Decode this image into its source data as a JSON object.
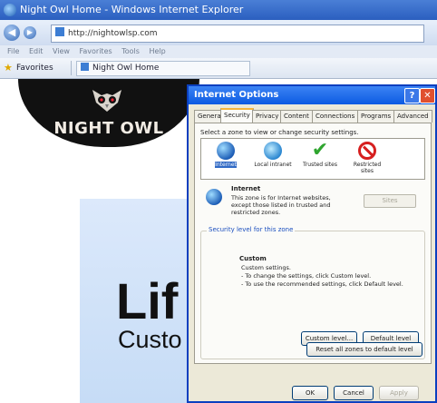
{
  "browser": {
    "title": "Night Owl Home - Windows Internet Explorer",
    "address": "http://nightowlsp.com",
    "menu": [
      "File",
      "Edit",
      "View",
      "Favorites",
      "Tools",
      "Help"
    ],
    "favorites_label": "Favorites",
    "tab_label": "Night Owl Home"
  },
  "page": {
    "brand": "NIGHT OWL",
    "promo_big": "Lif",
    "promo_sub": "Custo"
  },
  "dialog": {
    "title": "Internet Options",
    "tabs": [
      "General",
      "Security",
      "Privacy",
      "Content",
      "Connections",
      "Programs",
      "Advanced"
    ],
    "active_tab": "Security",
    "zone_caption": "Select a zone to view or change security settings.",
    "zones": [
      "Internet",
      "Local intranet",
      "Trusted sites",
      "Restricted sites"
    ],
    "sites_button": "Sites",
    "zone_title": "Internet",
    "zone_desc": "This zone is for Internet websites, except those listed in trusted and restricted zones.",
    "security_level_label": "Security level for this zone",
    "custom_title": "Custom",
    "custom_lines": [
      "Custom settings.",
      "- To change the settings, click Custom level.",
      "- To use the recommended settings, click Default level."
    ],
    "custom_level_button": "Custom level...",
    "default_level_button": "Default level",
    "reset_button": "Reset all zones to default level",
    "ok_button": "OK",
    "cancel_button": "Cancel",
    "apply_button": "Apply"
  }
}
